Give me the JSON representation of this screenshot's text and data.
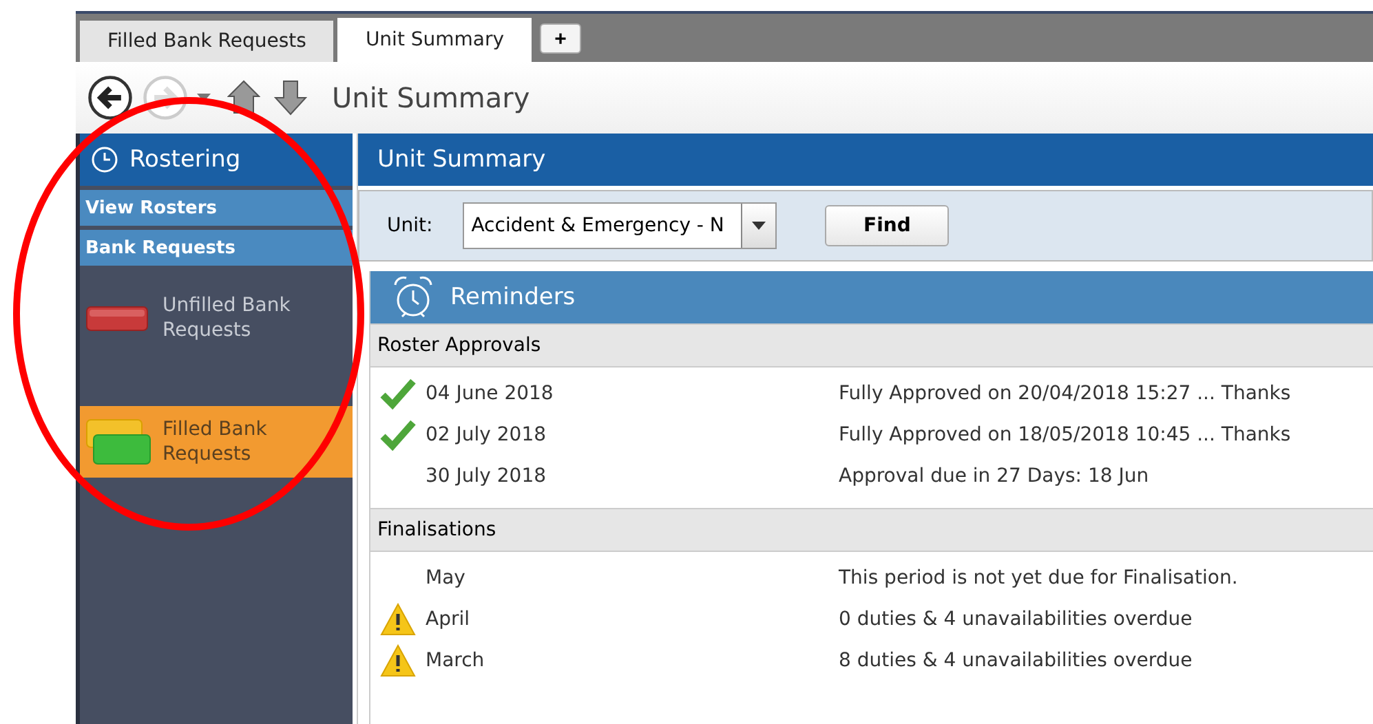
{
  "tabs": [
    {
      "label": "Filled Bank Requests",
      "selected": false
    },
    {
      "label": "Unit Summary",
      "selected": true
    }
  ],
  "new_tab": "+",
  "toolbar": {
    "title": "Unit Summary",
    "forward_disabled": true
  },
  "sidebar": {
    "title": "Rostering",
    "links": [
      "View Rosters",
      "Bank Requests"
    ],
    "items": [
      {
        "label": "Unfilled Bank Requests",
        "kind": "unfilled",
        "selected": false
      },
      {
        "label": "Filled Bank Requests",
        "kind": "filled",
        "selected": true
      }
    ]
  },
  "main": {
    "title": "Unit Summary",
    "unit_label": "Unit:",
    "unit_value": "Accident & Emergency - N",
    "find": "Find",
    "reminders": {
      "title": "Reminders",
      "sections": [
        {
          "title": "Roster Approvals",
          "rows": [
            {
              "kind": "check",
              "name": "04 June 2018",
              "detail": "Fully Approved on 20/04/2018 15:27 ... Thanks"
            },
            {
              "kind": "check",
              "name": "02 July 2018",
              "detail": "Fully Approved on 18/05/2018 10:45 ... Thanks"
            },
            {
              "kind": "plain",
              "name": "30 July 2018",
              "detail": "Approval due in 27 Days: 18 Jun"
            }
          ]
        },
        {
          "title": "Finalisations",
          "rows": [
            {
              "kind": "plain",
              "name": "May",
              "detail": "This period is not yet due for Finalisation."
            },
            {
              "kind": "warning",
              "name": "April",
              "detail": "0 duties & 4 unavailabilities overdue"
            },
            {
              "kind": "warning",
              "name": "March",
              "detail": "8 duties & 4 unavailabilities overdue"
            }
          ]
        }
      ]
    }
  },
  "annotation": {
    "kind": "circle"
  }
}
